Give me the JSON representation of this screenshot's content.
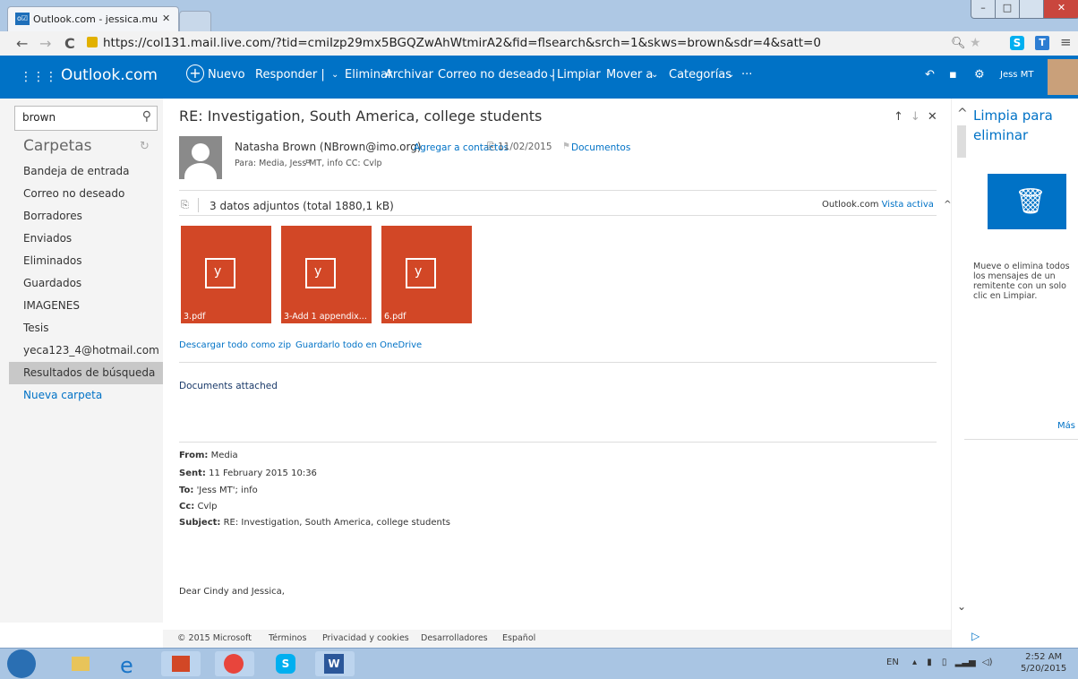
{
  "browser": {
    "tab_title": "Outlook.com - jessica.mur",
    "tab_close": "✕",
    "tab_favicon": "o☑",
    "url": "https://col131.mail.live.com/?tid=cmiIzp29mx5BGQZwAhWtmirA2&fid=flsearch&srch=1&skws=brown&sdr=4&satt=0",
    "window_min": "–",
    "window_max": "□",
    "window_close": "✕"
  },
  "header": {
    "brand": "Outlook.com",
    "new_label": "Nuevo",
    "reply_label": "Responder |",
    "delete_label": "Eliminar",
    "archive_label": "Archivar",
    "junk_label": "Correo no deseado |",
    "sweep_label": "Limpiar",
    "move_label": "Mover a",
    "categories_label": "Categorías",
    "more_label": "···",
    "user_name": "Jess MT"
  },
  "sidebar": {
    "search_value": "brown",
    "folders_title": "Carpetas",
    "items": [
      {
        "label": "Bandeja de entrada"
      },
      {
        "label": "Correo no deseado"
      },
      {
        "label": "Borradores"
      },
      {
        "label": "Enviados"
      },
      {
        "label": "Eliminados"
      },
      {
        "label": "Guardados"
      },
      {
        "label": "IMAGENES"
      },
      {
        "label": "Tesis"
      },
      {
        "label": "yeca123_4@hotmail.com"
      },
      {
        "label": "Resultados de búsqueda"
      }
    ],
    "new_folder": "Nueva carpeta"
  },
  "message": {
    "subject": "RE: Investigation, South America, college students",
    "sender": "Natasha Brown (NBrown@imo.org)",
    "add_contact": "Agregar a contactos",
    "date": "11/02/2015",
    "category": "Documentos",
    "recipients": "Para: Media, Jess MT, info CC: Cvlp",
    "attachments_summary": "3 datos adjuntos (total 1880,1 kB)",
    "active_view_prefix": "Outlook.com",
    "active_view_link": "Vista activa",
    "attachments": [
      {
        "name": "3.pdf"
      },
      {
        "name": "3-Add 1 appendix..."
      },
      {
        "name": "6.pdf"
      }
    ],
    "download_zip": "Descargar todo como zip",
    "save_onedrive": "Guardarlo todo en OneDrive",
    "body_first": "Documents attached",
    "quoted": {
      "from_label": "From:",
      "from": "Media",
      "sent_label": "Sent:",
      "sent": "11 February 2015 10:36",
      "to_label": "To:",
      "to": "'Jess MT'; info",
      "cc_label": "Cc:",
      "cc": "Cvlp",
      "subject_label": "Subject:",
      "subject": "RE: Investigation, South America, college students"
    },
    "greeting": "Dear Cindy and Jessica,"
  },
  "footer": {
    "copyright": "© 2015 Microsoft",
    "terms": "Términos",
    "privacy": "Privacidad y cookies",
    "developers": "Desarrolladores",
    "language": "Español"
  },
  "right_pane": {
    "title": "Limpia para eliminar",
    "description": "Mueve o elimina todos los mensajes de un remitente con un solo clic en Limpiar.",
    "more": "Más"
  },
  "taskbar": {
    "lang": "EN",
    "time": "2:52 AM",
    "date": "5/20/2015"
  },
  "colors": {
    "brand": "#0072c6",
    "attachment_tile": "#d24726"
  }
}
